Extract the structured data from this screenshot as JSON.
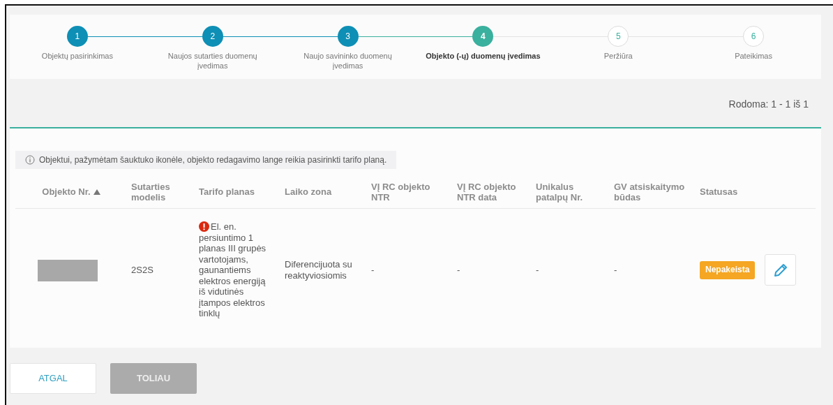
{
  "stepper": {
    "steps": [
      {
        "number": "1",
        "label": "Objektų pasirinkimas",
        "completed": true,
        "current": false
      },
      {
        "number": "2",
        "label": "Naujos sutarties duomenų įvedimas",
        "completed": true,
        "current": false
      },
      {
        "number": "3",
        "label": "Naujo savininko duomenų įvedimas",
        "completed": true,
        "current": false
      },
      {
        "number": "4",
        "label": "Objekto (-ų) duomenų įvedimas",
        "completed": false,
        "current": true
      },
      {
        "number": "5",
        "label": "Peržiūra",
        "completed": false,
        "current": false
      },
      {
        "number": "6",
        "label": "Pateikimas",
        "completed": false,
        "current": false
      }
    ]
  },
  "pagination": {
    "text": "Rodoma: 1 - 1 iš 1"
  },
  "info_note": "Objektui, pažymėtam šauktuko ikonėle, objekto redagavimo lange reikia pasirinkti tarifo planą.",
  "table": {
    "columns": [
      {
        "label": "Objekto Nr.",
        "sorted": true
      },
      {
        "label": "Sutarties modelis",
        "sorted": false
      },
      {
        "label": "Tarifo planas",
        "sorted": false
      },
      {
        "label": "Laiko zona",
        "sorted": false
      },
      {
        "label": "VĮ RC objekto NTR",
        "sorted": false
      },
      {
        "label": "VĮ RC objekto NTR data",
        "sorted": false
      },
      {
        "label": "Unikalus patalpų Nr.",
        "sorted": false
      },
      {
        "label": "GV atsiskaitymo būdas",
        "sorted": false
      },
      {
        "label": "Statusas",
        "sorted": false
      }
    ],
    "rows": [
      {
        "object_redacted": true,
        "model": "2S2S",
        "tariff": "El. en. persiuntimo 1 planas III grupės vartotojams, gaunantiems elektros energiją iš vidutinės įtampos elektros tinklų",
        "tariff_warning": true,
        "time_zone": "Diferencijuota su reaktyviosiomis",
        "ntr": "-",
        "ntr_date": "-",
        "premises_no": "-",
        "gv_method": "-",
        "status": "Nepakeista"
      }
    ]
  },
  "buttons": [
    {
      "label": "ATGAL",
      "disabled": false
    },
    {
      "label": "TOLIAU",
      "disabled": true
    }
  ]
}
